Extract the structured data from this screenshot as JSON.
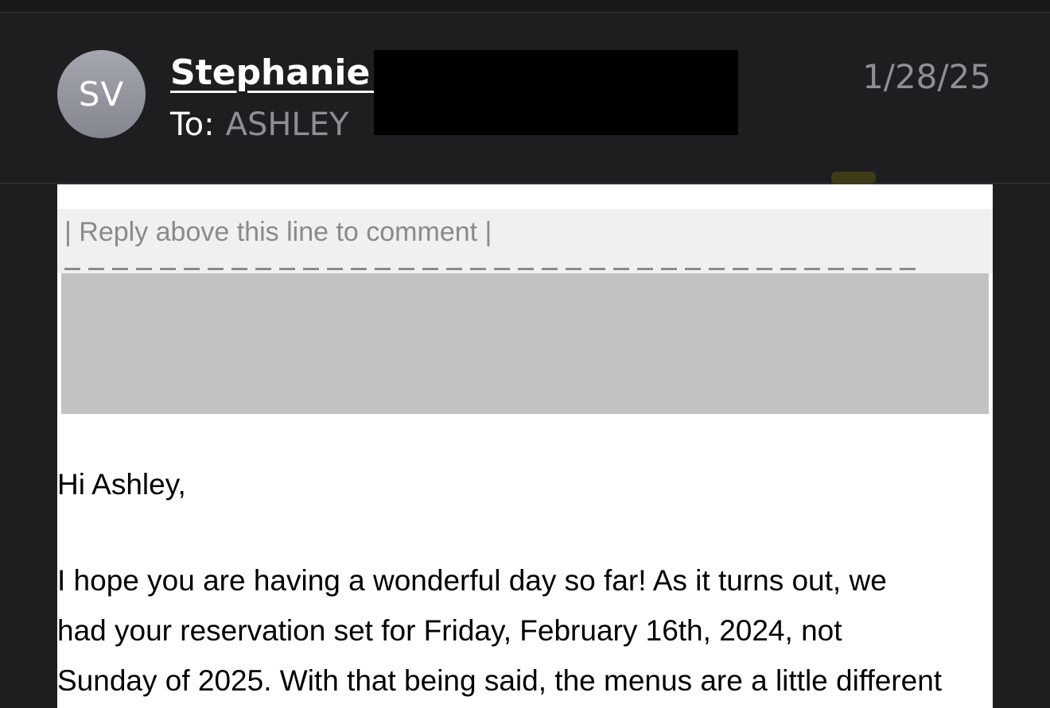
{
  "email": {
    "sender": {
      "initials": "SV",
      "name": "Stephanie V"
    },
    "recipient": {
      "label": "To:",
      "name": "ASHLEY"
    },
    "date": "1/28/25"
  },
  "body": {
    "reply_line": "| Reply above this line to comment |",
    "greeting": "Hi Ashley,",
    "paragraph_lines": [
      "I hope you are having a wonderful day so far! As it turns out, we",
      "had your reservation set for Friday, February 16th, 2024, not",
      "Sunday of 2025. With that being said, the menus are a little different"
    ]
  },
  "colors": {
    "background": "#1e1e20",
    "avatar": "#9a9ca5",
    "secondary_text": "#8e8e93",
    "redaction": "#000000",
    "body_background": "#ffffff",
    "reply_banner": "#f0f0f0",
    "redacted_block": "#c2c2c2"
  }
}
